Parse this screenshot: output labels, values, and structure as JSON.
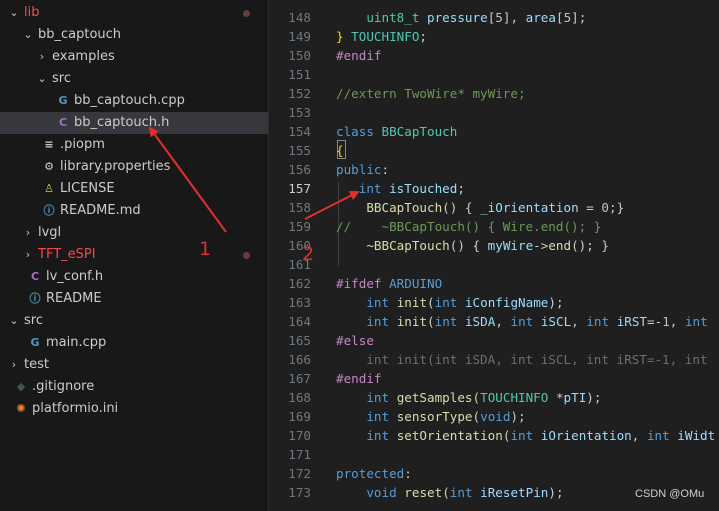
{
  "sidebar": {
    "items": [
      {
        "label": "lib",
        "chevron": "v",
        "icon": "",
        "color": "#f14c4c"
      },
      {
        "label": "bb_captouch",
        "chevron": "v",
        "icon": "",
        "color": "#cccccc"
      },
      {
        "label": "examples",
        "chevron": ">",
        "icon": "",
        "color": "#cccccc"
      },
      {
        "label": "src",
        "chevron": "v",
        "icon": "",
        "color": "#cccccc"
      },
      {
        "label": "bb_captouch.cpp",
        "chevron": "",
        "icon": "cpp-file-icon",
        "color": "#cccccc"
      },
      {
        "label": "bb_captouch.h",
        "chevron": "",
        "icon": "c-header-file-icon",
        "color": "#cccccc"
      },
      {
        "label": ".piopm",
        "chevron": "",
        "icon": "text-file-icon",
        "color": "#cccccc"
      },
      {
        "label": "library.properties",
        "chevron": "",
        "icon": "gear-icon",
        "color": "#cccccc"
      },
      {
        "label": "LICENSE",
        "chevron": "",
        "icon": "license-icon",
        "color": "#cccccc"
      },
      {
        "label": "README.md",
        "chevron": "",
        "icon": "info-icon",
        "color": "#cccccc"
      },
      {
        "label": "lvgl",
        "chevron": ">",
        "icon": "",
        "color": "#cccccc"
      },
      {
        "label": "TFT_eSPI",
        "chevron": ">",
        "icon": "",
        "color": "#f14c4c"
      },
      {
        "label": "lv_conf.h",
        "chevron": "",
        "icon": "c-header-file-icon",
        "color": "#cccccc"
      },
      {
        "label": "README",
        "chevron": "",
        "icon": "info-icon",
        "color": "#cccccc"
      },
      {
        "label": "src",
        "chevron": "v",
        "icon": "",
        "color": "#cccccc"
      },
      {
        "label": "main.cpp",
        "chevron": "",
        "icon": "cpp-file-icon",
        "color": "#cccccc"
      },
      {
        "label": "test",
        "chevron": ">",
        "icon": "",
        "color": "#cccccc"
      },
      {
        "label": ".gitignore",
        "chevron": "",
        "icon": "git-icon",
        "color": "#cccccc"
      },
      {
        "label": "platformio.ini",
        "chevron": "",
        "icon": "platformio-icon",
        "color": "#cccccc"
      }
    ]
  },
  "editor": {
    "active_line": "157",
    "lines": [
      {
        "n": "148",
        "parts": [
          [
            "    ",
            ""
          ],
          [
            "uint8_t",
            "tok-ty"
          ],
          [
            " ",
            ""
          ],
          [
            "pressure",
            "tok-var"
          ],
          [
            "[",
            ""
          ],
          [
            "5",
            "tok-num"
          ],
          [
            "], ",
            ""
          ],
          [
            "area",
            "tok-var"
          ],
          [
            "[",
            ""
          ],
          [
            "5",
            "tok-num"
          ],
          [
            "];",
            ""
          ]
        ]
      },
      {
        "n": "149",
        "parts": [
          [
            "} ",
            "tok-br"
          ],
          [
            "TOUCHINFO",
            "tok-ty"
          ],
          [
            ";",
            ""
          ]
        ]
      },
      {
        "n": "150",
        "parts": [
          [
            "#endif",
            "tok-mac"
          ]
        ]
      },
      {
        "n": "151",
        "parts": []
      },
      {
        "n": "152",
        "parts": [
          [
            "//extern TwoWire* myWire;",
            "tok-cm"
          ]
        ]
      },
      {
        "n": "153",
        "parts": []
      },
      {
        "n": "154",
        "parts": [
          [
            "class",
            "tok-kw"
          ],
          [
            " ",
            ""
          ],
          [
            "BBCapTouch",
            "tok-ty"
          ]
        ]
      },
      {
        "n": "155",
        "parts": [
          [
            "{",
            "tok-br"
          ]
        ]
      },
      {
        "n": "156",
        "parts": [
          [
            "public",
            "tok-kw"
          ],
          [
            ":",
            ""
          ]
        ]
      },
      {
        "n": "157",
        "parts": [
          [
            "   ",
            ""
          ],
          [
            "int",
            "tok-kw"
          ],
          [
            " ",
            ""
          ],
          [
            "isTouched",
            "tok-var"
          ],
          [
            ";",
            ""
          ]
        ]
      },
      {
        "n": "158",
        "parts": [
          [
            "    ",
            ""
          ],
          [
            "BBCapTouch",
            "tok-fn"
          ],
          [
            "() { ",
            ""
          ],
          [
            "_iOrientation",
            "tok-var"
          ],
          [
            " = ",
            ""
          ],
          [
            "0",
            "tok-num"
          ],
          [
            ";}",
            ""
          ]
        ]
      },
      {
        "n": "159",
        "parts": [
          [
            "//    ~BBCapTouch() { Wire.end(); }",
            "tok-cm"
          ]
        ]
      },
      {
        "n": "160",
        "parts": [
          [
            "    ",
            ""
          ],
          [
            "~BBCapTouch",
            "tok-fn"
          ],
          [
            "() { ",
            ""
          ],
          [
            "myWire",
            "tok-var"
          ],
          [
            "->",
            ""
          ],
          [
            "end",
            "tok-fn"
          ],
          [
            "(); }",
            ""
          ]
        ]
      },
      {
        "n": "161",
        "parts": []
      },
      {
        "n": "162",
        "parts": [
          [
            "#ifdef",
            "tok-mac"
          ],
          [
            " ",
            ""
          ],
          [
            "ARDUINO",
            "tok-def"
          ]
        ]
      },
      {
        "n": "163",
        "parts": [
          [
            "    ",
            ""
          ],
          [
            "int",
            "tok-kw"
          ],
          [
            " ",
            ""
          ],
          [
            "init",
            "tok-fn"
          ],
          [
            "(",
            ""
          ],
          [
            "int",
            "tok-kw"
          ],
          [
            " ",
            ""
          ],
          [
            "iConfigName",
            "tok-var"
          ],
          [
            ");",
            ""
          ]
        ]
      },
      {
        "n": "164",
        "parts": [
          [
            "    ",
            ""
          ],
          [
            "int",
            "tok-kw"
          ],
          [
            " ",
            ""
          ],
          [
            "init",
            "tok-fn"
          ],
          [
            "(",
            ""
          ],
          [
            "int",
            "tok-kw"
          ],
          [
            " ",
            ""
          ],
          [
            "iSDA",
            "tok-var"
          ],
          [
            ", ",
            ""
          ],
          [
            "int",
            "tok-kw"
          ],
          [
            " ",
            ""
          ],
          [
            "iSCL",
            "tok-var"
          ],
          [
            ", ",
            ""
          ],
          [
            "int",
            "tok-kw"
          ],
          [
            " ",
            ""
          ],
          [
            "iRST",
            "tok-var"
          ],
          [
            "=-",
            ""
          ],
          [
            "1",
            "tok-num"
          ],
          [
            ", ",
            ""
          ],
          [
            "int",
            "tok-kw"
          ]
        ]
      },
      {
        "n": "165",
        "parts": [
          [
            "#else",
            "tok-mac"
          ]
        ]
      },
      {
        "n": "166",
        "parts": [
          [
            "    int init(int iSDA, int iSCL, int iRST=-1, int",
            "tok-dim"
          ]
        ]
      },
      {
        "n": "167",
        "parts": [
          [
            "#endif",
            "tok-mac"
          ]
        ]
      },
      {
        "n": "168",
        "parts": [
          [
            "    ",
            ""
          ],
          [
            "int",
            "tok-kw"
          ],
          [
            " ",
            ""
          ],
          [
            "getSamples",
            "tok-fn"
          ],
          [
            "(",
            ""
          ],
          [
            "TOUCHINFO",
            "tok-ty"
          ],
          [
            " *",
            ""
          ],
          [
            "pTI",
            "tok-var"
          ],
          [
            ");",
            ""
          ]
        ]
      },
      {
        "n": "169",
        "parts": [
          [
            "    ",
            ""
          ],
          [
            "int",
            "tok-kw"
          ],
          [
            " ",
            ""
          ],
          [
            "sensorType",
            "tok-fn"
          ],
          [
            "(",
            ""
          ],
          [
            "void",
            "tok-kw"
          ],
          [
            ");",
            ""
          ]
        ]
      },
      {
        "n": "170",
        "parts": [
          [
            "    ",
            ""
          ],
          [
            "int",
            "tok-kw"
          ],
          [
            " ",
            ""
          ],
          [
            "setOrientation",
            "tok-fn"
          ],
          [
            "(",
            ""
          ],
          [
            "int",
            "tok-kw"
          ],
          [
            " ",
            ""
          ],
          [
            "iOrientation",
            "tok-var"
          ],
          [
            ", ",
            ""
          ],
          [
            "int",
            "tok-kw"
          ],
          [
            " ",
            ""
          ],
          [
            "iWidt",
            "tok-var"
          ]
        ]
      },
      {
        "n": "171",
        "parts": []
      },
      {
        "n": "172",
        "parts": [
          [
            "protected",
            "tok-kw"
          ],
          [
            ":",
            ""
          ]
        ]
      },
      {
        "n": "173",
        "parts": [
          [
            "    ",
            ""
          ],
          [
            "void",
            "tok-kw"
          ],
          [
            " ",
            ""
          ],
          [
            "reset",
            "tok-fn"
          ],
          [
            "(",
            ""
          ],
          [
            "int",
            "tok-kw"
          ],
          [
            " ",
            ""
          ],
          [
            "iResetPin",
            "tok-var"
          ],
          [
            ");",
            ""
          ]
        ]
      }
    ]
  },
  "annotations": {
    "label_1": "1",
    "label_2": "2",
    "accent": "#e0302b"
  },
  "watermark": "CSDN @OMu"
}
